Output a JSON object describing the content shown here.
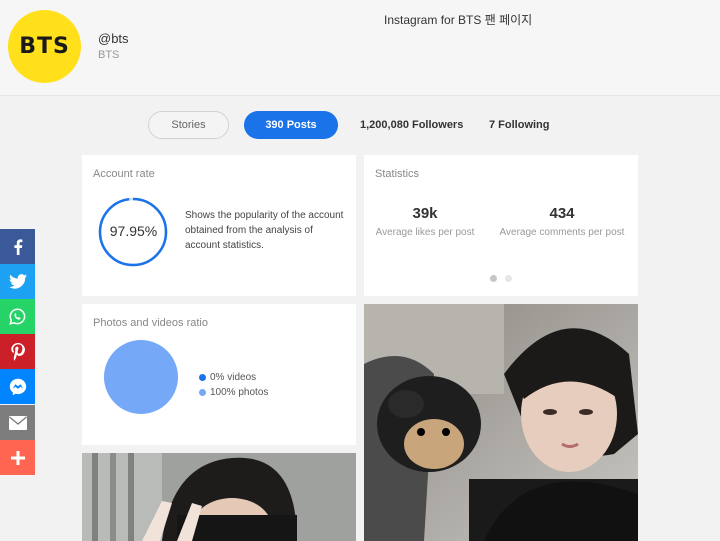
{
  "page": {
    "title": "Instagram for BTS 팬 페이지"
  },
  "profile": {
    "avatar_text": "BTS",
    "avatar_color": "#ffe01b",
    "handle": "@bts",
    "name": "BTS"
  },
  "tabs": {
    "stories": "Stories",
    "posts": "390 Posts",
    "followers": "1,200,080 Followers",
    "following": "7 Following",
    "active_color": "#1a73e8"
  },
  "account_rate": {
    "title": "Account rate",
    "value": "97.95%",
    "fraction": 0.9795,
    "description": "Shows the popularity of the account obtained from the analysis of account statistics."
  },
  "statistics": {
    "title": "Statistics",
    "likes_value": "39k",
    "likes_label": "Average likes per post",
    "comments_value": "434",
    "comments_label": "Average comments per post",
    "carousel_active_index": 0,
    "carousel_count": 2
  },
  "ratio": {
    "title": "Photos and videos ratio",
    "videos_label": "0% videos",
    "photos_label": "100% photos",
    "videos_fraction": 0,
    "photos_fraction": 1,
    "videos_color": "#1a73e8",
    "photos_color": "#75a8f7"
  },
  "share": {
    "items": [
      "facebook-icon",
      "twitter-icon",
      "whatsapp-icon",
      "pinterest-icon",
      "messenger-icon",
      "email-icon",
      "more-icon"
    ],
    "colors": [
      "#3b5998",
      "#1da1f2",
      "#25d366",
      "#cb2027",
      "#0084ff",
      "#7d7d7d",
      "#ff6550"
    ]
  }
}
